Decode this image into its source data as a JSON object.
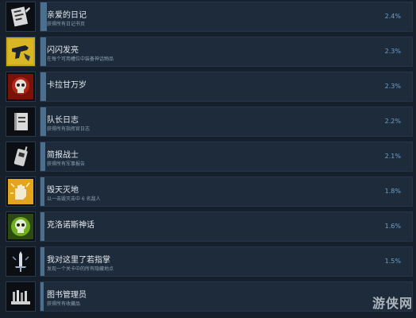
{
  "achievements": [
    {
      "title": "亲爱的日记",
      "desc": "获得所有日记书页",
      "percent": "2.4%",
      "icon": "journal-icon"
    },
    {
      "title": "闪闪发亮",
      "desc": "在每个可用槽位中装备神话物品",
      "percent": "2.3%",
      "icon": "gun-icon"
    },
    {
      "title": "卡拉甘万岁",
      "desc": "",
      "percent": "2.3%",
      "icon": "skull-icon"
    },
    {
      "title": "队长日志",
      "desc": "获得所有指挥官日志",
      "percent": "2.2%",
      "icon": "logbook-icon"
    },
    {
      "title": "简报战士",
      "desc": "获得所有军事报告",
      "percent": "2.1%",
      "icon": "radio-icon"
    },
    {
      "title": "毁天灭地",
      "desc": "以一击毁灭击中 6 名敌人",
      "percent": "1.8%",
      "icon": "fist-icon"
    },
    {
      "title": "克洛诺斯神话",
      "desc": "",
      "percent": "1.6%",
      "icon": "green-skull-icon"
    },
    {
      "title": "我对这里了若指掌",
      "desc": "发现一个关卡中的所有隐藏地点",
      "percent": "1.5%",
      "icon": "sword-icon"
    },
    {
      "title": "图书管理员",
      "desc": "获得所有收藏品",
      "percent": "",
      "icon": "library-icon"
    }
  ],
  "watermark": {
    "text": "游侠网"
  },
  "colors": {
    "background": "#16202d",
    "bar": "#1e2b3b",
    "fill": "#4b6f8f",
    "percent": "#6fa0c9"
  }
}
